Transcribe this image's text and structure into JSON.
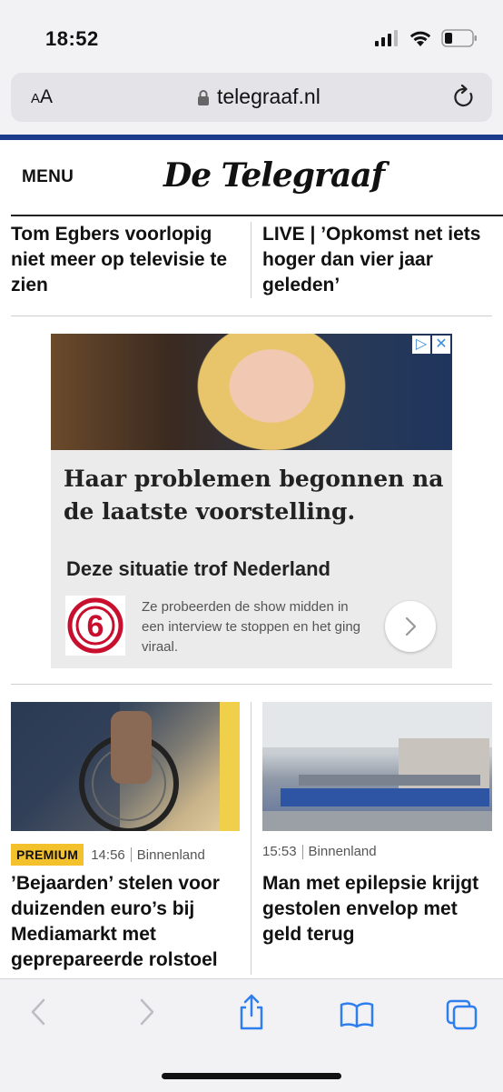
{
  "status": {
    "time": "18:52"
  },
  "browser": {
    "text_size_label_small": "A",
    "text_size_label_large": "A",
    "url": "telegraaf.nl"
  },
  "site": {
    "menu_label": "MENU",
    "logo_text": "De Telegraaf"
  },
  "top_headlines": [
    {
      "text": "Tom Egbers voorlopig niet meer op televisie te zien"
    },
    {
      "text": "LIVE | ’Opkomst net iets hoger dan vier jaar geleden’"
    }
  ],
  "ad": {
    "headline": "Haar problemen begonnen na de laatste voorstelling.",
    "subtitle": "Deze situatie trof Nederland",
    "body": "Ze probeerden de show midden in een interview te stoppen en het ging viraal.",
    "logo_text": "6"
  },
  "articles": [
    {
      "badge": "PREMIUM",
      "time": "14:56",
      "section": "Binnenland",
      "title": "’Bejaarden’ stelen voor duizenden euro’s bij Mediamarkt met geprepareerde rolstoel"
    },
    {
      "time": "15:53",
      "section": "Binnenland",
      "title": "Man met epilepsie krijgt gestolen envelop met geld terug"
    }
  ],
  "colors": {
    "brand_blue": "#1b3c8c",
    "premium_yellow": "#f3c12b"
  }
}
